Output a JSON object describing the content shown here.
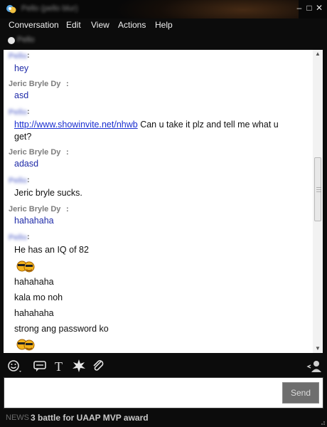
{
  "window": {
    "title": "Pello (pello blur)",
    "controls": {
      "minimize": "–",
      "maximize": "□",
      "close": "✕"
    }
  },
  "menu": [
    "Conversation",
    "Edit",
    "View",
    "Actions",
    "Help"
  ],
  "status": {
    "name": "Pello"
  },
  "conversation": {
    "m1": {
      "sender": "Pello",
      "lines": [
        "hey"
      ]
    },
    "m2": {
      "sender": "Jeric Bryle Dy",
      "lines": [
        "asd"
      ]
    },
    "m3": {
      "sender": "Pello",
      "link": "http://www.showinvite.net/nhwb",
      "lines": [
        "Can u take it plz and tell me what u",
        "get?"
      ]
    },
    "m4": {
      "sender": "Jeric Bryle Dy",
      "lines": [
        "adasd"
      ]
    },
    "m5": {
      "sender": "Pello",
      "lines": [
        "Jeric bryle sucks."
      ]
    },
    "m6": {
      "sender": "Jeric Bryle Dy",
      "lines": [
        "hahahaha"
      ]
    },
    "m7": {
      "sender": "Pello",
      "lines": [
        "He has an IQ of 82",
        "hahahaha",
        "kala mo noh",
        "hahahaha",
        "strong ang password ko"
      ]
    }
  },
  "input": {
    "send_label": "Send"
  },
  "news": {
    "label": "NEWS",
    "headline": "3 battle for UAAP MVP award"
  },
  "colors": {
    "self_text": "#1e2aa8",
    "link": "#1a2fd0",
    "frame": "#0c0c0c"
  }
}
